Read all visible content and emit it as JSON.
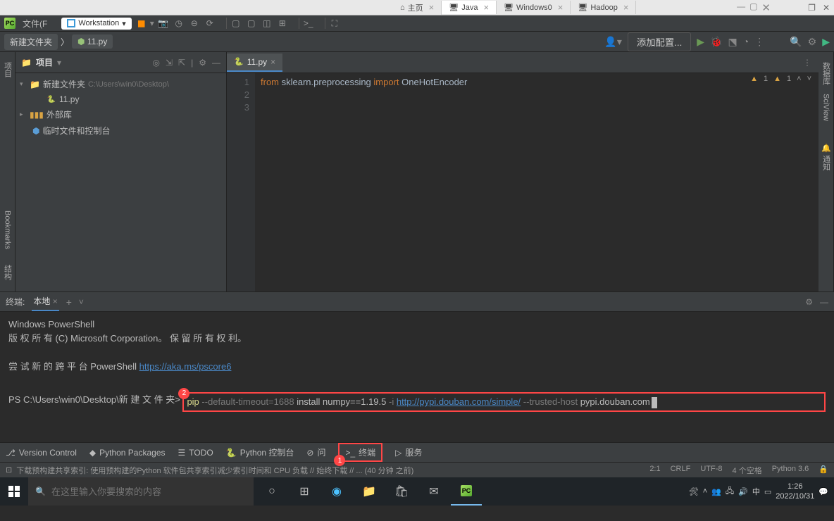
{
  "vm_tabs": {
    "home": "主页",
    "java": "Java",
    "win": "Windows0",
    "hadoop": "Hadoop"
  },
  "top": {
    "menu_file": "文件(F",
    "workstation": "Workstation"
  },
  "nav": {
    "crumb1": "新建文件夹",
    "crumb2": "11.py",
    "add_config": "添加配置..."
  },
  "proj": {
    "title": "项目",
    "folder": "新建文件夹",
    "folder_path": "C:\\Users\\win0\\Desktop\\",
    "file1": "11.py",
    "ext_lib": "外部库",
    "scratch": "临时文件和控制台"
  },
  "editor": {
    "tab": "11.py",
    "lines": [
      "1",
      "2",
      "3"
    ],
    "code1": "from sklearn.preprocessing import OneHotEncoder",
    "warn1": "1",
    "warn2": "1"
  },
  "term": {
    "title": "终端:",
    "tab": "本地",
    "l1": "Windows PowerShell",
    "l2": "版 权 所 有 (C) Microsoft Corporation。 保 留 所 有 权 利。",
    "l3_pre": "尝 试 新 的 跨 平 台 PowerShell ",
    "l3_link": "https://aka.ms/pscore6",
    "prompt": "PS C:\\Users\\win0\\Desktop\\新 建 文 件 夹> ",
    "cmd_pip": "pip",
    "cmd_timeout": " --default-timeout=1688 ",
    "cmd_install": "install numpy==1.19.5 ",
    "cmd_i": "-i ",
    "cmd_url": "http://pypi.douban.com/simple/",
    "cmd_trust": " --trusted-host ",
    "cmd_host": "pypi.douban.com"
  },
  "tools": {
    "vcs": "Version Control",
    "pkg": "Python Packages",
    "todo": "TODO",
    "pycon": "Python 控制台",
    "problems": "问",
    "terminal": "终端",
    "services": "服务"
  },
  "status": {
    "msg": "下载预构建共享索引: 使用预构建的Python 软件包共享索引减少索引时间和 CPU 负载 // 始终下载 // ... (40 分钟 之前)",
    "pos": "2:1",
    "eol": "CRLF",
    "enc": "UTF-8",
    "indent": "4 个空格",
    "interp": "Python 3.6"
  },
  "taskbar": {
    "search_ph": "在这里输入你要搜索的内容",
    "time": "1:26",
    "date": "2022/10/31"
  },
  "side": {
    "proj": "项目",
    "bookmarks": "Bookmarks",
    "struct": "结构",
    "db": "数据库",
    "sci": "SciView",
    "notif": "通知"
  }
}
